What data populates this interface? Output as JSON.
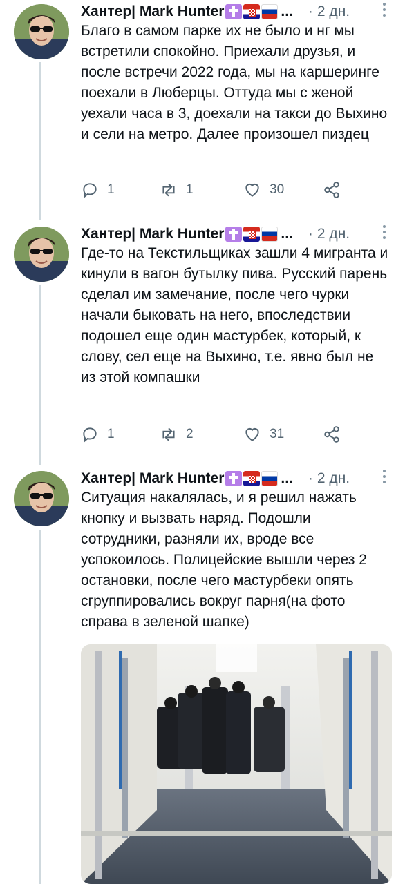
{
  "tweets": [
    {
      "author": "Хантер| Mark Hunter",
      "time": "2 дн.",
      "text": "Благо в самом парке их не было и нг мы встретили спокойно. Приехали друзья, и после встречи 2022 года, мы на каршеринге поехали в Люберцы. Оттуда мы с женой уехали часа в 3, доехали на такси до Выхино и сели на метро. Далее произошел пиздец",
      "replies": "1",
      "retweets": "1",
      "likes": "30"
    },
    {
      "author": "Хантер| Mark Hunter",
      "time": "2 дн.",
      "text": "Где-то на Текстильщиках зашли 4 мигранта и кинули в вагон бутылку пива. Русский парень сделал им замечание, после чего чурки начали быковать на него, впоследствии подошел еще один мастурбек, который, к слову, сел еще на Выхино, т.е. явно был не из этой компашки",
      "replies": "1",
      "retweets": "2",
      "likes": "31"
    },
    {
      "author": "Хантер| Mark Hunter",
      "time": "2 дн.",
      "text": "Ситуация накалялась, и я решил нажать кнопку и вызвать наряд. Подошли сотрудники, разняли их, вроде все успокоилось. Полицейские вышли через 2 остановки, после чего мастурбеки опять сгруппировались вокруг парня(на фото справа в зеленой шапке)"
    }
  ],
  "ellipsis": "...",
  "separator": "·",
  "icons": [
    "reply-icon",
    "retweet-icon",
    "like-icon",
    "share-icon",
    "more-icon",
    "cross-badge",
    "croatia-flag",
    "russia-flag"
  ],
  "colors": {
    "secondary": "#536471",
    "thread_line": "#cfd9de"
  }
}
